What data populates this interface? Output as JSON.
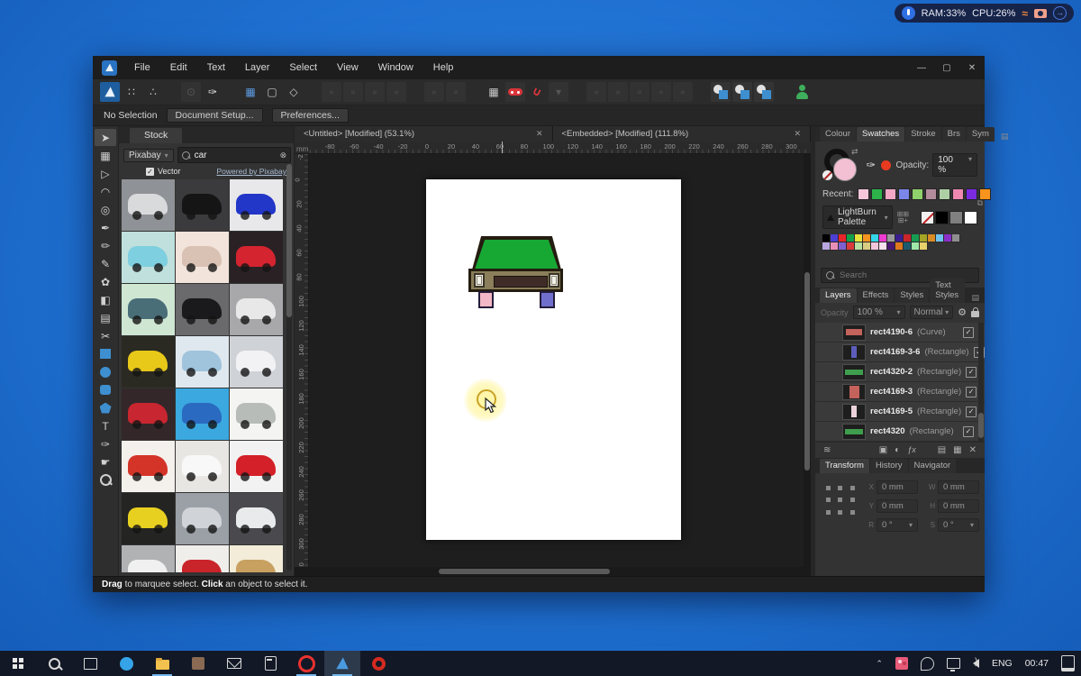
{
  "system_pill": {
    "ram": "RAM:33%",
    "cpu": "CPU:26%"
  },
  "titlebar": {
    "menus": [
      "File",
      "Edit",
      "Text",
      "Layer",
      "Select",
      "View",
      "Window",
      "Help"
    ],
    "controls": {
      "minimize": "—",
      "maximize": "▢",
      "close": "✕"
    }
  },
  "toolbar": {
    "items": [
      {
        "name": "vector-persona-button",
        "kind": "logo",
        "active": true
      },
      {
        "name": "pixel-persona-button",
        "glyph": "∷"
      },
      {
        "name": "export-persona-button",
        "glyph": "∴"
      },
      {
        "name": "gap"
      },
      {
        "name": "place-image-button",
        "glyph": "⊙",
        "dim": true
      },
      {
        "name": "style-picker-button",
        "glyph": "✑",
        "light": true
      },
      {
        "name": "gap"
      },
      {
        "name": "snap-grid-button",
        "glyph": "▦",
        "blue": true
      },
      {
        "name": "marquee-mode-button",
        "glyph": "▢"
      },
      {
        "name": "transform-mode-button",
        "glyph": "◇"
      },
      {
        "name": "gap"
      },
      {
        "name": "arrange-front-button",
        "glyph": "▫",
        "dim": true
      },
      {
        "name": "arrange-up-button",
        "glyph": "▫",
        "dim": true
      },
      {
        "name": "arrange-down-button",
        "glyph": "▫",
        "dim": true
      },
      {
        "name": "arrange-back-button",
        "glyph": "▫",
        "dim": true
      },
      {
        "name": "gap"
      },
      {
        "name": "align-button",
        "glyph": "▫",
        "dim": true
      },
      {
        "name": "distribute-button",
        "glyph": "▫",
        "dim": true
      },
      {
        "name": "gap"
      },
      {
        "name": "grid-toggle-button",
        "glyph": "▦"
      },
      {
        "name": "snapping-presets-button",
        "kind": "snappill"
      },
      {
        "name": "snapping-toggle-button",
        "kind": "magnet",
        "glyph": "∪"
      },
      {
        "name": "snapping-caret-button",
        "glyph": "▾",
        "dim": true
      },
      {
        "name": "gap"
      },
      {
        "name": "disabled-button-1",
        "glyph": "▫",
        "dim": true
      },
      {
        "name": "disabled-button-2",
        "glyph": "▫",
        "dim": true
      },
      {
        "name": "disabled-button-3",
        "glyph": "▫",
        "dim": true
      },
      {
        "name": "disabled-button-4",
        "glyph": "▫",
        "dim": true
      },
      {
        "name": "disabled-button-5",
        "glyph": "▫",
        "dim": true
      },
      {
        "name": "gap"
      },
      {
        "name": "boolean-add-button",
        "kind": "bool"
      },
      {
        "name": "boolean-subtract-button",
        "kind": "bool"
      },
      {
        "name": "boolean-intersect-button",
        "kind": "bool"
      },
      {
        "name": "gap"
      },
      {
        "name": "account-button",
        "kind": "person"
      }
    ]
  },
  "context_bar": {
    "status": "No Selection",
    "document_setup": "Document Setup...",
    "preferences": "Preferences..."
  },
  "tools": [
    {
      "name": "move-tool",
      "glyph": "➤",
      "selected": true
    },
    {
      "name": "artboard-tool",
      "glyph": "▦"
    },
    {
      "name": "node-tool",
      "glyph": "▷"
    },
    {
      "name": "corner-tool",
      "glyph": "◠"
    },
    {
      "name": "point-transform-tool",
      "glyph": "◎"
    },
    {
      "name": "pen-tool",
      "glyph": "✒"
    },
    {
      "name": "pencil-tool",
      "glyph": "✏"
    },
    {
      "name": "vector-brush-tool",
      "glyph": "✎"
    },
    {
      "name": "paint-brush-tool",
      "glyph": "✿"
    },
    {
      "name": "fill-tool",
      "glyph": "◧"
    },
    {
      "name": "picture-frame-tool",
      "glyph": "▤"
    },
    {
      "name": "crop-tool",
      "glyph": "✂"
    },
    {
      "name": "rectangle-tool",
      "shape": "rect"
    },
    {
      "name": "ellipse-tool",
      "shape": "ellipse"
    },
    {
      "name": "rounded-rectangle-tool",
      "shape": "rounded"
    },
    {
      "name": "polygon-tool",
      "shape": "polygon"
    },
    {
      "name": "text-tool",
      "glyph": "T"
    },
    {
      "name": "colour-picker-tool",
      "glyph": "✑"
    },
    {
      "name": "view-tool",
      "glyph": "☛"
    },
    {
      "name": "zoom-tool",
      "shape": "mag"
    }
  ],
  "stock": {
    "tab": "Stock",
    "provider": "Pixabay",
    "search_value": "car",
    "vector_label": "Vector",
    "powered": "Powered by Pixabay",
    "thumbnails": [
      {
        "label": "silver sports car",
        "bg": "#8f9296",
        "car": "#d8dadc"
      },
      {
        "label": "black classic car",
        "bg": "#3b3b3d",
        "car": "#151515"
      },
      {
        "label": "blue roadster",
        "bg": "#e8e8ea",
        "car": "#2236c8"
      },
      {
        "label": "teal cartoon beetle",
        "bg": "#bfe0dc",
        "car": "#7ecfdf"
      },
      {
        "label": "sphynx cat illustration",
        "bg": "#f2e4da",
        "car": "#d9c2b4"
      },
      {
        "label": "red supercar",
        "bg": "#2a2124",
        "car": "#d42430"
      },
      {
        "label": "green cartoon car with luggage",
        "bg": "#cfe6d2",
        "car": "#4a6e78"
      },
      {
        "label": "black vintage car",
        "bg": "#6a6a6c",
        "car": "#1a1a1c"
      },
      {
        "label": "white vintage car",
        "bg": "#a8a8aa",
        "car": "#e8e8e8"
      },
      {
        "label": "yellow supercar",
        "bg": "#2a2a22",
        "car": "#e8c818"
      },
      {
        "label": "blue classic car",
        "bg": "#dfe8ee",
        "car": "#9fc4dc"
      },
      {
        "label": "white coupe",
        "bg": "#cfd2d6",
        "car": "#f2f2f4"
      },
      {
        "label": "red classic car",
        "bg": "#33272a",
        "car": "#c82630"
      },
      {
        "label": "blue cartoon car",
        "bg": "#3ba8e0",
        "car": "#2a6ac0"
      },
      {
        "label": "race track map",
        "bg": "#f4f4f2",
        "car": "#b8bcb8"
      },
      {
        "label": "red cartoon 2cv",
        "bg": "#f4f0ec",
        "car": "#d43428"
      },
      {
        "label": "white car with red wheels",
        "bg": "#e8e6e2",
        "car": "#f8f8f8"
      },
      {
        "label": "red sports car",
        "bg": "#f2f2f2",
        "car": "#d42028"
      },
      {
        "label": "yellow sports car",
        "bg": "#242422",
        "car": "#e8d020"
      },
      {
        "label": "silver sedan",
        "bg": "#9aa0a6",
        "car": "#d0d4d8"
      },
      {
        "label": "white sports car",
        "bg": "#4a4a4e",
        "car": "#e8eaec"
      },
      {
        "label": "white classic car",
        "bg": "#b0b2b4",
        "car": "#f0f0f0"
      },
      {
        "label": "red vintage car",
        "bg": "#f0eeea",
        "car": "#c8242a"
      },
      {
        "label": "tan car icon",
        "bg": "#f2ecd8",
        "car": "#c8a060"
      }
    ]
  },
  "doc_tabs": [
    {
      "label": "<Untitled> [Modified] (53.1%)",
      "close": "✕"
    },
    {
      "label": "<Embedded> [Modified] (111.8%)",
      "close": "✕"
    }
  ],
  "ruler": {
    "unit": "mm",
    "top": {
      "min": -80,
      "max": 300,
      "step": 20
    },
    "left": {
      "min": -20,
      "max": 320,
      "step": 20
    }
  },
  "artwork": {
    "windshield_color": "#17a834",
    "body_color": "#8a7f5a",
    "grille_color": "#3f2c28",
    "wheel_left_color": "#f2b8c6",
    "wheel_right_color": "#7070cc",
    "outline_color": "#241c10"
  },
  "colour_panel": {
    "tabs": [
      "Colour",
      "Swatches",
      "Stroke",
      "Brs",
      "Sym"
    ],
    "active_tab": "Swatches",
    "opacity_label": "Opacity:",
    "opacity_value": "100 %",
    "recent_label": "Recent:",
    "recent": [
      "#f6c6da",
      "#2db34a",
      "#f3a8c6",
      "#7b86e8",
      "#8fd16a",
      "#b38d9b",
      "#aecfa6",
      "#ef87b1",
      "#7a2be2",
      "#f7941d"
    ],
    "palette_name": "LightBurn Palette",
    "quick_swatches": [
      "none",
      "#000000",
      "#808080",
      "#ffffff"
    ],
    "palette": [
      [
        "#000000",
        "#4b3fd4",
        "#e8262a",
        "#14a04a",
        "#e8e23a",
        "#f7941d",
        "#35d6e8",
        "#ee3bd0",
        "#9a9a9a",
        "#3a1d8e",
        "#c9252b",
        "#169c52",
        "#a5a424",
        "#d98b26",
        "#6fc3ef",
        "#8b2fc9",
        "#8f8f8f"
      ],
      [
        "#b9a6e0",
        "#e88fb8",
        "#7f5fd0",
        "#d93a3a",
        "#b8e0a0",
        "#d8cc82",
        "#f2c6dc",
        "#f6e0ee",
        "#4a1770",
        "#e07820",
        "#1d5a6e",
        "#9fe8a8",
        "#e8d06a"
      ]
    ],
    "fill_color": "#f2c0d2"
  },
  "search": {
    "placeholder": "Search"
  },
  "layers_panel": {
    "tabs": [
      "Layers",
      "Effects",
      "Styles",
      "Text Styles"
    ],
    "active_tab": "Layers",
    "opacity_label": "Opacity",
    "opacity_value": "100 %",
    "blend_mode": "Normal",
    "rows": [
      {
        "name": "rect4190-6",
        "type": "(Curve)",
        "thumb": {
          "color": "#c4625c",
          "w": 18,
          "h": 7
        },
        "checked": true
      },
      {
        "name": "rect4169-3-6",
        "type": "(Rectangle)",
        "thumb": {
          "color": "#5d5dba",
          "w": 6,
          "h": 13
        },
        "checked": true
      },
      {
        "name": "rect4320-2",
        "type": "(Rectangle)",
        "thumb": {
          "color": "#3f9e4d",
          "w": 20,
          "h": 6
        },
        "checked": true
      },
      {
        "name": "rect4169-3",
        "type": "(Rectangle)",
        "thumb": {
          "color": "#c4625c",
          "w": 11,
          "h": 14
        },
        "checked": true
      },
      {
        "name": "rect4169-5",
        "type": "(Rectangle)",
        "thumb": {
          "color": "#ead2da",
          "w": 6,
          "h": 13
        },
        "checked": true
      },
      {
        "name": "rect4320",
        "type": "(Rectangle)",
        "thumb": {
          "color": "#3f9e4d",
          "w": 20,
          "h": 6
        },
        "checked": true
      }
    ]
  },
  "transform_panel": {
    "tabs": [
      "Transform",
      "History",
      "Navigator"
    ],
    "active_tab": "Transform",
    "fields": [
      {
        "label": "X",
        "value": "0 mm"
      },
      {
        "label": "W",
        "value": "0 mm"
      },
      {
        "label": "Y",
        "value": "0 mm"
      },
      {
        "label": "H",
        "value": "0 mm"
      },
      {
        "label": "R",
        "value": "0 °",
        "dropdown": true
      },
      {
        "label": "S",
        "value": "0 °",
        "dropdown": true
      }
    ]
  },
  "status_bar": {
    "parts": [
      {
        "text": "Drag",
        "bold": true
      },
      {
        "text": " to marquee select. "
      },
      {
        "text": "Click",
        "bold": true
      },
      {
        "text": " an object to select it."
      }
    ]
  },
  "taskbar": {
    "language": "ENG",
    "time": "00:47",
    "items": [
      {
        "name": "start-button",
        "kind": "win"
      },
      {
        "name": "search-button",
        "kind": "mag2"
      },
      {
        "name": "task-view-button",
        "kind": "rects"
      },
      {
        "name": "edge-browser",
        "kind": "circle",
        "color": "#35a3e8"
      },
      {
        "name": "file-explorer",
        "kind": "folder",
        "running": true
      },
      {
        "name": "photos-app",
        "kind": "square",
        "color": "#8a6a52"
      },
      {
        "name": "mail-app",
        "kind": "envelope"
      },
      {
        "name": "calculator-app",
        "kind": "calc"
      },
      {
        "name": "opera-browser",
        "kind": "ring",
        "running": true
      },
      {
        "name": "affinity-designer",
        "kind": "tri",
        "active": true,
        "running": true
      },
      {
        "name": "red-app",
        "kind": "swirl",
        "color": "#d42a20"
      }
    ],
    "tray": [
      {
        "name": "tray-expand-caret",
        "kind": "caret",
        "glyph": "⌃"
      },
      {
        "name": "meet-now-icon",
        "kind": "people"
      },
      {
        "name": "onedrive-icon",
        "kind": "od"
      },
      {
        "name": "network-icon",
        "kind": "net"
      },
      {
        "name": "volume-icon",
        "kind": "spk"
      }
    ]
  }
}
